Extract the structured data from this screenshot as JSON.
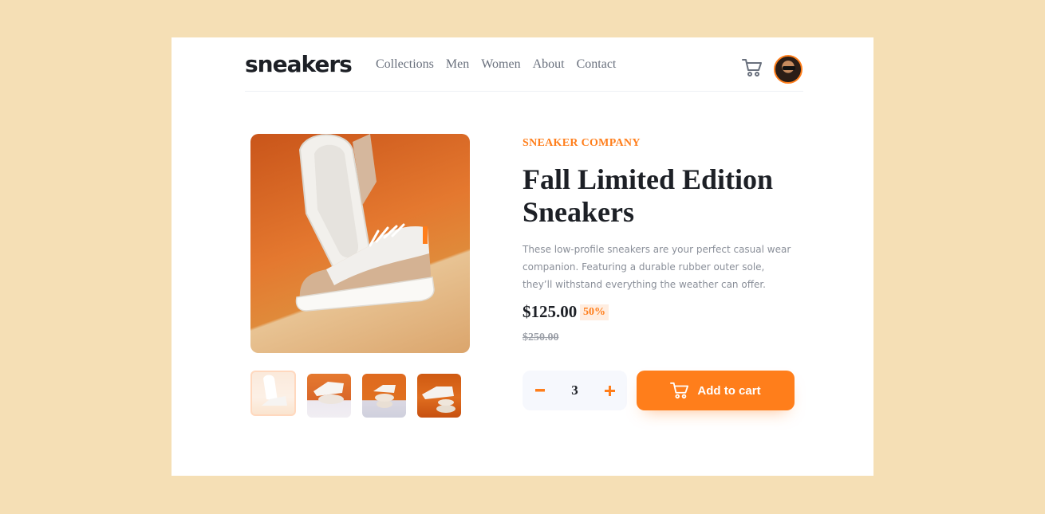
{
  "header": {
    "logo": "sneakers",
    "nav": [
      "Collections",
      "Men",
      "Women",
      "About",
      "Contact"
    ]
  },
  "product": {
    "company": "SNEAKER COMPANY",
    "title": "Fall Limited Edition Sneakers",
    "description": "These low-profile sneakers are your perfect casual wear companion. Featuring a durable rubber outer sole, they’ll withstand everything the weather can offer.",
    "price": "$125.00",
    "discount": "50%",
    "old_price": "$250.00",
    "quantity": "3",
    "add_to_cart_label": "Add to cart"
  },
  "colors": {
    "accent": "#ff7e1b",
    "background": "#f5dfb5",
    "text_dark": "#1d2026",
    "text_grey": "#69707d"
  },
  "icons": {
    "cart": "cart-icon",
    "minus": "minus-icon",
    "plus": "plus-icon"
  }
}
